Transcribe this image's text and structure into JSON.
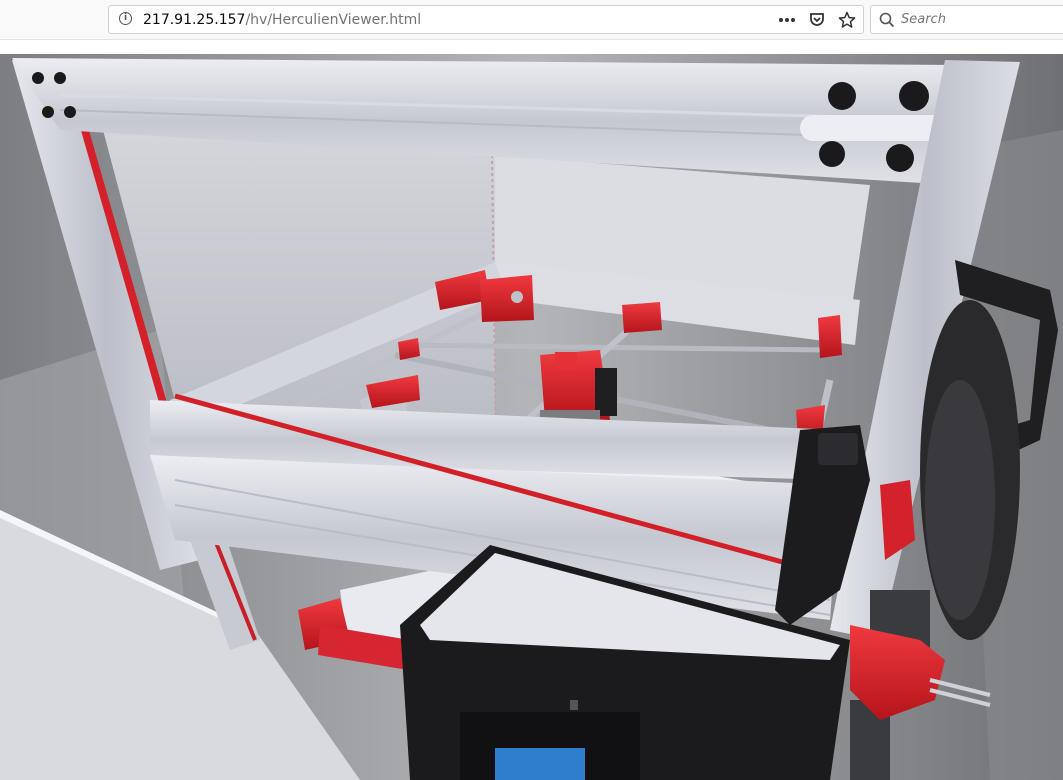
{
  "browser": {
    "url_host": "217.91.25.157",
    "url_path": "/hv/HerculienViewer.html",
    "search_placeholder": "Search",
    "icons": {
      "site_info": "info-icon",
      "page_actions": "more-horizontal-icon",
      "pocket": "pocket-icon",
      "bookmark": "star-icon",
      "search": "search-icon"
    }
  },
  "viewer": {
    "scene": "3d-printer-model",
    "colors": {
      "frame": "#c9cbd4",
      "accent_red": "#d8202a",
      "panel": "#e4e5ea",
      "dark_part": "#1e1e20",
      "floor": "#8a8b8e"
    }
  }
}
